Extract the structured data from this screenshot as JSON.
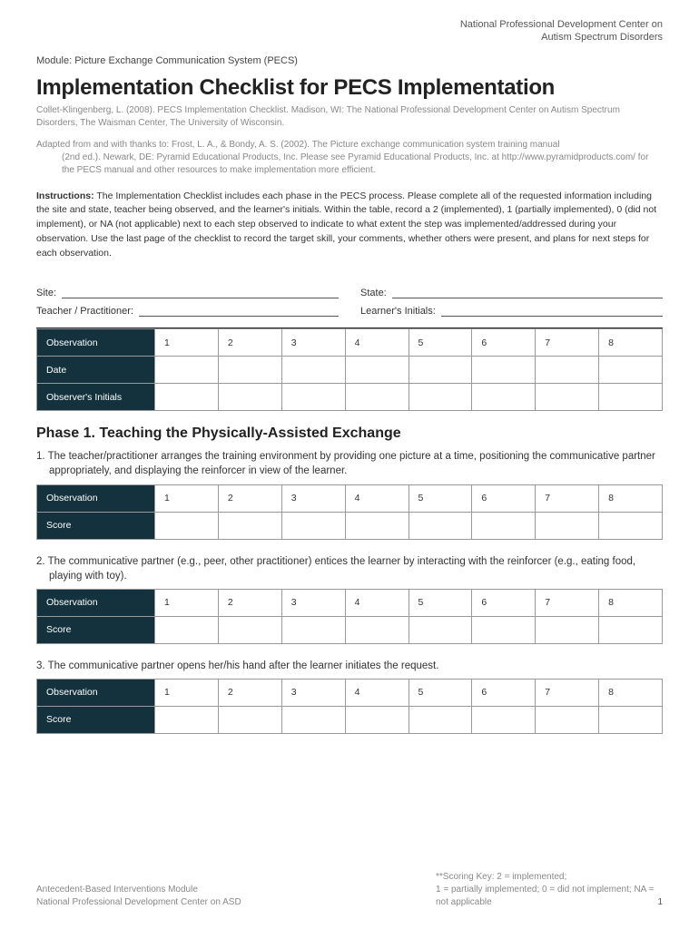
{
  "header": {
    "org_line1": "National Professional Development Center on",
    "org_line2": "Autism Spectrum Disorders"
  },
  "module_line": "Module: Picture Exchange Communication System (PECS)",
  "title": "Implementation Checklist for PECS Implementation",
  "citation": "Collet-Klingenberg, L. (2008). PECS Implementation Checklist. Madison, WI: The National Professional Development Center on Autism Spectrum Disorders, The Waisman Center, The University of Wisconsin.",
  "adapted_lead": "Adapted from and with thanks to:  Frost, L. A., & Bondy, A. S. (2002). The Picture exchange communication system training manual",
  "adapted_rest": "(2nd ed.). Newark, DE: Pyramid Educational Products, Inc. Please see Pyramid Educational Products, Inc. at http://www.pyramidproducts.com/ for the PECS manual and other resources to make implementation more efficient.",
  "instructions_label": "Instructions:",
  "instructions_body": " The Implementation Checklist includes each phase in the PECS process. Please complete all of the requested information including the site and state, teacher being observed, and the learner's initials. Within the table, record a 2 (implemented), 1 (partially implemented), 0 (did not implement), or NA (not applicable) next to each step observed to indicate to what extent the step was implemented/addressed during your observation. Use the last page of the checklist to record the target skill, your comments, whether others were present, and plans for next steps for each observation.",
  "fields": {
    "site": "Site:",
    "state": "State:",
    "teacher": "Teacher / Practitioner:",
    "learner": "Learner's Initials:"
  },
  "row_labels": {
    "observation": "Observation",
    "date": "Date",
    "observer": "Observer's Initials",
    "score": "Score"
  },
  "columns": [
    "1",
    "2",
    "3",
    "4",
    "5",
    "6",
    "7",
    "8"
  ],
  "phase_title": "Phase 1. Teaching the Physically-Assisted Exchange",
  "steps": {
    "s1": "1.  The teacher/practitioner arranges the training environment by providing one picture at a time, positioning the communicative partner appropriately, and displaying the reinforcer in view of the learner.",
    "s2": "2.  The communicative partner (e.g., peer, other practitioner) entices the learner by interacting with the reinforcer (e.g., eating food, playing with toy).",
    "s3": "3.  The communicative partner opens her/his hand after the learner initiates the request."
  },
  "footer": {
    "left_line1": "Antecedent-Based Interventions Module",
    "left_line2": "National Professional Development Center on ASD",
    "key_line1": "**Scoring Key: 2 = implemented;",
    "key_line2": "1 = partially implemented; 0 =  did not implement; NA = not applicable",
    "page": "1"
  }
}
